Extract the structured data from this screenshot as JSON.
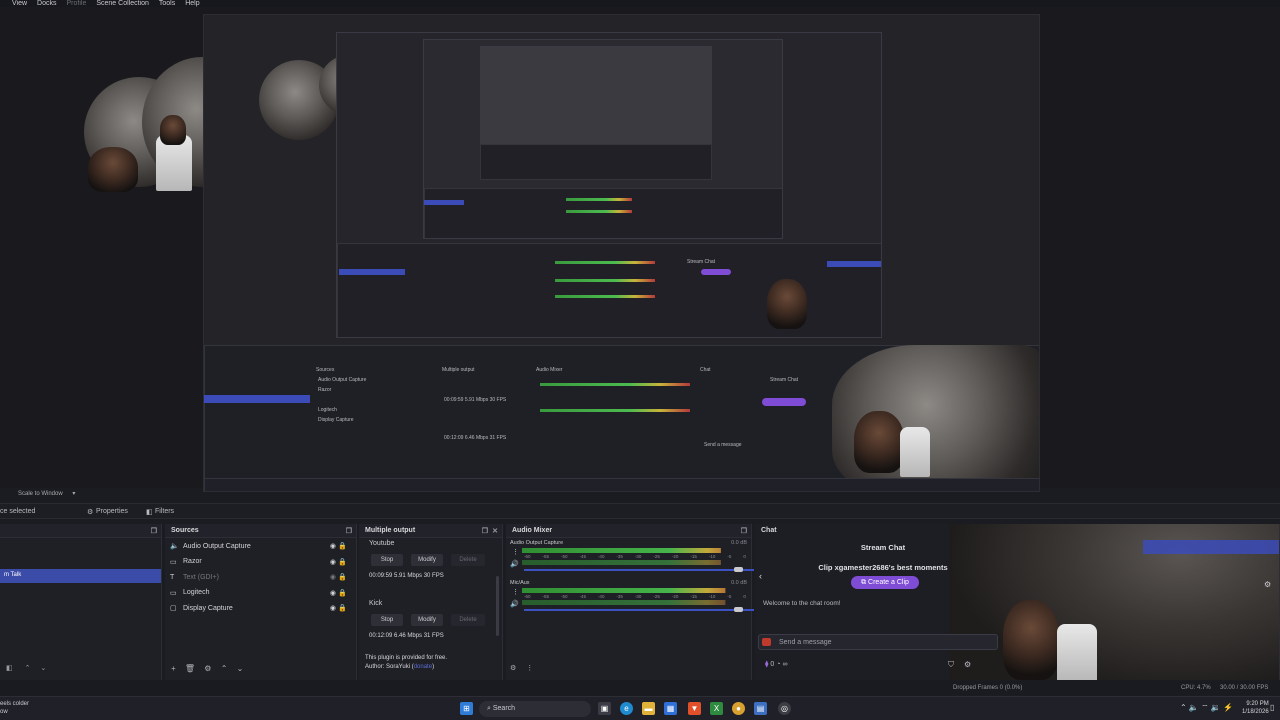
{
  "menu": [
    "View",
    "Docks",
    "Profile",
    "Scene Collection",
    "Tools",
    "Help"
  ],
  "toolbar": {
    "scale_label": "Scale to Window",
    "no_source": "ce selected",
    "properties": "Properties",
    "filters": "Filters"
  },
  "scenes": {
    "selected_item": "m Talk"
  },
  "sources": {
    "title": "Sources",
    "items": [
      {
        "icon": "speaker-icon",
        "glyph": "🔈",
        "label": "Audio Output Capture",
        "disabled": false
      },
      {
        "icon": "camera-icon",
        "glyph": "▭",
        "label": "Razor",
        "disabled": false
      },
      {
        "icon": "text-icon",
        "glyph": "T",
        "label": "Text (GDI+)",
        "disabled": true
      },
      {
        "icon": "camera-icon",
        "glyph": "▭",
        "label": "Logitech",
        "disabled": false
      },
      {
        "icon": "monitor-icon",
        "glyph": "▢",
        "label": "Display Capture",
        "disabled": false
      }
    ]
  },
  "multiple_output": {
    "title": "Multiple output",
    "targets": [
      {
        "name": "Youtube",
        "stop": "Stop",
        "modify": "Modify",
        "delete": "Delete",
        "stats": "00:09:59  5.91 Mbps  30 FPS"
      },
      {
        "name": "Kick",
        "stop": "Stop",
        "modify": "Modify",
        "delete": "Delete",
        "stats": "00:12:09  6.46 Mbps  31 FPS"
      }
    ],
    "footer_line1": "This plugin is provided for free.",
    "footer_line2": "Author: SoraYuki (",
    "footer_link": "donate",
    "footer_end": ")"
  },
  "audio_mixer": {
    "title": "Audio Mixer",
    "channels": [
      {
        "name": "Audio Output Capture",
        "db": "0.0 dB",
        "level": 0.88
      },
      {
        "name": "Mic/Aux",
        "db": "0.0 dB",
        "level": 0.9
      }
    ],
    "ticks": [
      "-60",
      "-55",
      "-50",
      "-45",
      "-40",
      "-35",
      "-30",
      "-25",
      "-20",
      "-15",
      "-10",
      "-5",
      "0"
    ]
  },
  "chat": {
    "title": "Chat",
    "header": "Stream Chat",
    "clip_text": "Clip xgamester2686's best moments",
    "clip_button": "Create a Clip",
    "welcome": "Welcome to the chat room!",
    "input_placeholder": "Send a message",
    "points": "0"
  },
  "status": {
    "left": "eels colder",
    "left2": "ow",
    "dropped": "Dropped Frames 0 (0.0%)",
    "cpu": "CPU: 4.7%",
    "fps": "30.00 / 30.00 FPS"
  },
  "taskbar": {
    "search": "Search",
    "time": "9:20 PM",
    "date": "1/18/2026"
  },
  "colors": {
    "accent": "#3b4ba8",
    "purple": "#7f4cd6",
    "meter_green": "#46b54a",
    "meter_yellow": "#c2a93a",
    "meter_red": "#a8342f"
  }
}
